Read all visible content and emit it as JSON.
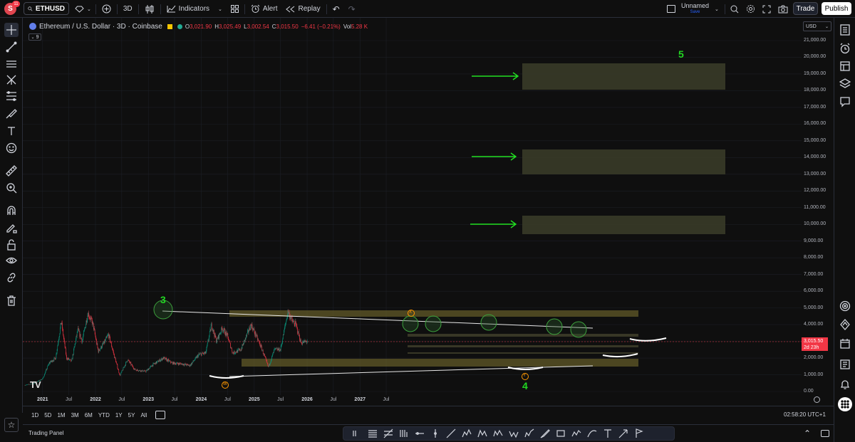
{
  "topbar": {
    "avatar_letter": "S",
    "avatar_badge": "11",
    "symbol": "ETHUSD",
    "interval": "3D",
    "indicators_label": "Indicators",
    "alert_label": "Alert",
    "replay_label": "Replay",
    "layout_name": "Unnamed",
    "layout_status": "Save",
    "trade_label": "Trade",
    "publish_label": "Publish"
  },
  "legend": {
    "title": "Ethereum / U.S. Dollar · 3D · Coinbase",
    "o_label": "O",
    "o_value": "3,021.90",
    "h_label": "H",
    "h_value": "3,025.49",
    "l_label": "L",
    "l_value": "3,002.54",
    "c_label": "C",
    "c_value": "3,015.50",
    "change": "−6.41 (−0.21%)",
    "vol_label": "Vol",
    "vol_value": "5.28 K",
    "indicator_count": "9"
  },
  "price_axis": {
    "currency": "USD",
    "ticks": [
      "21,000.00",
      "20,000.00",
      "19,000.00",
      "18,000.00",
      "17,000.00",
      "16,000.00",
      "15,000.00",
      "14,000.00",
      "13,000.00",
      "12,000.00",
      "11,000.00",
      "10,000.00",
      "9,000.00",
      "8,000.00",
      "7,000.00",
      "6,000.00",
      "5,000.00",
      "4,000.00",
      "3,000.00",
      "2,000.00",
      "1,000.00",
      "0.00"
    ],
    "last_price": "3,015.50",
    "countdown": "2d 23h"
  },
  "time_axis": {
    "ticks": [
      "2021",
      "Jul",
      "2022",
      "Jul",
      "2023",
      "Jul",
      "2024",
      "Jul",
      "2025",
      "Jul",
      "2026",
      "Jul",
      "2027",
      "Jul"
    ]
  },
  "annotations": {
    "wave_3": "3",
    "wave_4": "4",
    "wave_5": "5",
    "circle_w": "W",
    "circle_x": "X",
    "circle_y": "Y"
  },
  "bottombar": {
    "ranges": [
      "1D",
      "5D",
      "1M",
      "3M",
      "6M",
      "YTD",
      "1Y",
      "5Y",
      "All"
    ],
    "clock": "02:58:20 UTC+1",
    "trading_panel": "Trading Panel"
  },
  "chart_data": {
    "type": "candlestick",
    "symbol": "ETHUSD",
    "ylim": [
      0,
      21000
    ],
    "close_path": [
      [
        "2020-09-01",
        380
      ],
      [
        "2020-11-01",
        480
      ],
      [
        "2021-01-01",
        750
      ],
      [
        "2021-02-15",
        1700
      ],
      [
        "2021-04-01",
        2000
      ],
      [
        "2021-05-10",
        4200
      ],
      [
        "2021-06-15",
        2000
      ],
      [
        "2021-07-20",
        1800
      ],
      [
        "2021-09-01",
        3700
      ],
      [
        "2021-10-01",
        3000
      ],
      [
        "2021-11-10",
        4700
      ],
      [
        "2021-12-15",
        4000
      ],
      [
        "2022-01-20",
        2400
      ],
      [
        "2022-03-01",
        2900
      ],
      [
        "2022-04-01",
        3400
      ],
      [
        "2022-05-15",
        2000
      ],
      [
        "2022-06-18",
        950
      ],
      [
        "2022-08-10",
        1900
      ],
      [
        "2022-10-01",
        1300
      ],
      [
        "2022-12-15",
        1200
      ],
      [
        "2023-02-01",
        1600
      ],
      [
        "2023-04-15",
        2000
      ],
      [
        "2023-06-15",
        1700
      ],
      [
        "2023-08-20",
        1650
      ],
      [
        "2023-10-15",
        1550
      ],
      [
        "2023-12-15",
        2200
      ],
      [
        "2024-02-01",
        2300
      ],
      [
        "2024-03-12",
        4000
      ],
      [
        "2024-04-15",
        3000
      ],
      [
        "2024-05-25",
        3800
      ],
      [
        "2024-07-01",
        3300
      ],
      [
        "2024-08-05",
        2300
      ],
      [
        "2024-10-01",
        2500
      ],
      [
        "2024-12-10",
        4000
      ],
      [
        "2025-01-15",
        3300
      ],
      [
        "2025-02-20",
        2600
      ],
      [
        "2025-04-09",
        1450
      ],
      [
        "2025-05-20",
        2500
      ],
      [
        "2025-07-01",
        2500
      ],
      [
        "2025-08-22",
        4800
      ],
      [
        "2025-09-20",
        4200
      ],
      [
        "2025-10-15",
        4000
      ],
      [
        "2025-11-20",
        2900
      ],
      [
        "2026-01-05",
        3015.5
      ]
    ]
  }
}
